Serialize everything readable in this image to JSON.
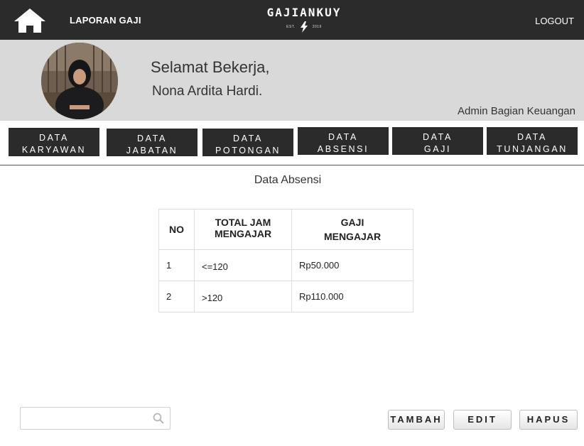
{
  "topbar": {
    "home_icon": "home-icon",
    "report_link": "LAPORAN GAJI",
    "brand_title": "GAJIANKUY",
    "brand_est": "EST.",
    "brand_year": "2019",
    "brand_icon": "lightning-icon",
    "logout": "LOGOUT"
  },
  "welcome": {
    "line1": "Selamat Bekerja,",
    "line2": "Nona Ardita Hardi.",
    "role": "Admin Bagian Keuangan"
  },
  "tabs": [
    {
      "line1": "DATA",
      "line2": "KARYAWAN"
    },
    {
      "line1": "DATA",
      "line2": "JABATAN"
    },
    {
      "line1": "DATA",
      "line2": "POTONGAN"
    },
    {
      "line1": "DATA",
      "line2": "ABSENSI"
    },
    {
      "line1": "DATA",
      "line2": "GAJI"
    },
    {
      "line1": "DATA",
      "line2": "TUNJANGAN"
    }
  ],
  "main": {
    "title": "Data Absensi",
    "table": {
      "headers": {
        "no": "NO",
        "total_line1": "TOTAL JAM",
        "total_line2": "MENGAJAR",
        "gaji_line1": "GAJI",
        "gaji_line2": "MENGAJAR"
      },
      "rows": [
        {
          "no": "1",
          "total": "<=120",
          "gaji": "Rp50.000"
        },
        {
          "no": "2",
          "total": ">120",
          "gaji": "Rp110.000"
        }
      ]
    }
  },
  "footer": {
    "search_value": "",
    "search_icon": "search-icon",
    "tambah": "TAMBAH",
    "edit": "EDIT",
    "hapus": "HAPUS"
  },
  "colors": {
    "bar": "#2b2b2b",
    "welcome_bg": "#d9d9d9"
  }
}
